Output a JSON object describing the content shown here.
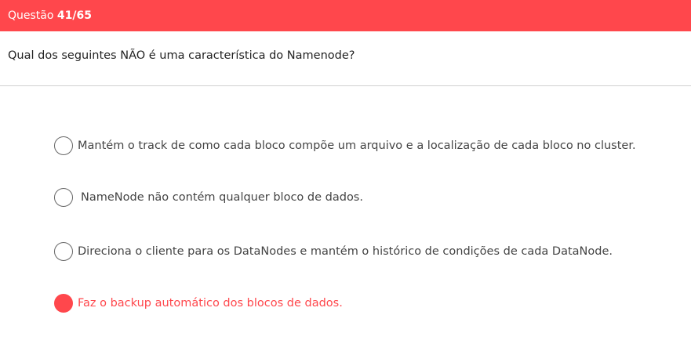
{
  "header": {
    "label": "Questão",
    "counter": "41/65",
    "color": "#ff474c"
  },
  "question": {
    "text": "Qual dos seguintes NÃO é uma característica do Namenode?"
  },
  "options": [
    {
      "label": "Mantém o track de como cada bloco compõe um arquivo e a localização de cada bloco no cluster.",
      "selected": false
    },
    {
      "label": "NameNode não contém qualquer bloco de dados.",
      "selected": false
    },
    {
      "label": "Direciona o cliente para os DataNodes e mantém o histórico de condições de cada DataNode.",
      "selected": false
    },
    {
      "label": "Faz o backup automático dos blocos de dados.",
      "selected": true
    }
  ]
}
